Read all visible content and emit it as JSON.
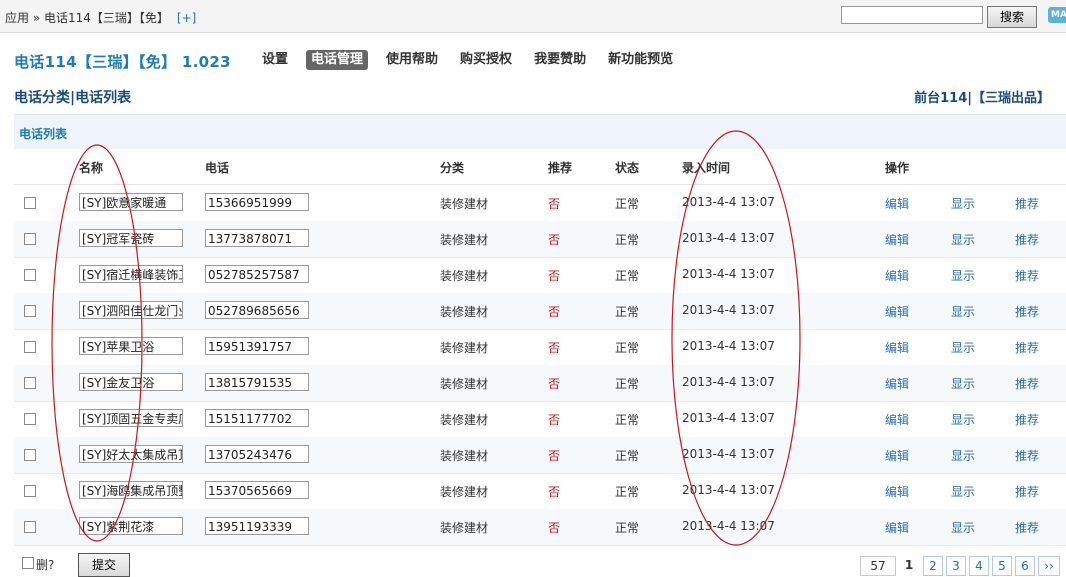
{
  "topbar": {
    "breadcrumb": "应用 » 电话114【三瑞】【免】",
    "plus": "[+]",
    "search_placeholder": "",
    "search_button": "搜索",
    "badge": "MA"
  },
  "app": {
    "title": "电话114【三瑞】【免】 1.023",
    "nav": [
      "设置",
      "电话管理",
      "使用帮助",
      "购买授权",
      "我要赞助",
      "新功能预览"
    ],
    "active_nav": "电话管理"
  },
  "page": {
    "subtitle": "电话分类|电话列表",
    "right_link": "前台114|【三瑞出品】",
    "section_title": "电话列表"
  },
  "table": {
    "headers": [
      "名称",
      "电话",
      "分类",
      "推荐",
      "状态",
      "录入时间",
      "操作"
    ],
    "rows": [
      {
        "name": "[SY]欧意家暖通",
        "phone": "15366951999",
        "category": "装修建材",
        "recommend": "否",
        "status": "正常",
        "time": "2013-4-4 13:07",
        "edit": "编辑",
        "show": "显示",
        "rec": "推荐"
      },
      {
        "name": "[SY]冠军瓷砖",
        "phone": "13773878071",
        "category": "装修建材",
        "recommend": "否",
        "status": "正常",
        "time": "2013-4-4 13:07",
        "edit": "编辑",
        "show": "显示",
        "rec": "推荐"
      },
      {
        "name": "[SY]宿迁横峰装饰工",
        "phone": "052785257587",
        "category": "装修建材",
        "recommend": "否",
        "status": "正常",
        "time": "2013-4-4 13:07",
        "edit": "编辑",
        "show": "显示",
        "rec": "推荐"
      },
      {
        "name": "[SY]泗阳佳仕龙门业",
        "phone": "052789685656",
        "category": "装修建材",
        "recommend": "否",
        "status": "正常",
        "time": "2013-4-4 13:07",
        "edit": "编辑",
        "show": "显示",
        "rec": "推荐"
      },
      {
        "name": "[SY]苹果卫浴",
        "phone": "15951391757",
        "category": "装修建材",
        "recommend": "否",
        "status": "正常",
        "time": "2013-4-4 13:07",
        "edit": "编辑",
        "show": "显示",
        "rec": "推荐"
      },
      {
        "name": "[SY]金友卫浴",
        "phone": "13815791535",
        "category": "装修建材",
        "recommend": "否",
        "status": "正常",
        "time": "2013-4-4 13:07",
        "edit": "编辑",
        "show": "显示",
        "rec": "推荐"
      },
      {
        "name": "[SY]顶固五金专卖店",
        "phone": "15151177702",
        "category": "装修建材",
        "recommend": "否",
        "status": "正常",
        "time": "2013-4-4 13:07",
        "edit": "编辑",
        "show": "显示",
        "rec": "推荐"
      },
      {
        "name": "[SY]好太太集成吊顶",
        "phone": "13705243476",
        "category": "装修建材",
        "recommend": "否",
        "status": "正常",
        "time": "2013-4-4 13:07",
        "edit": "编辑",
        "show": "显示",
        "rec": "推荐"
      },
      {
        "name": "[SY]海鸥集成吊顶整",
        "phone": "15370565669",
        "category": "装修建材",
        "recommend": "否",
        "status": "正常",
        "time": "2013-4-4 13:07",
        "edit": "编辑",
        "show": "显示",
        "rec": "推荐"
      },
      {
        "name": "[SY]紫荆花漆",
        "phone": "13951193339",
        "category": "装修建材",
        "recommend": "否",
        "status": "正常",
        "time": "2013-4-4 13:07",
        "edit": "编辑",
        "show": "显示",
        "rec": "推荐"
      }
    ]
  },
  "footer": {
    "delete_label": "删?",
    "submit_label": "提交",
    "pagination": {
      "total": "57",
      "pages": [
        "1",
        "2",
        "3",
        "4",
        "5",
        "6"
      ],
      "current": "1",
      "next": "››"
    }
  },
  "colors": {
    "accent": "#1f7cb0",
    "no_red": "#c8161d",
    "link": "#2a6fb0",
    "annotation_ellipse": "#c8161d"
  }
}
